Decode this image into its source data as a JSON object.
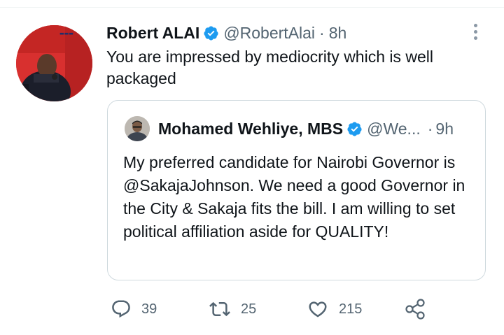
{
  "tweet": {
    "author_name": "Robert ALAI",
    "author_handle": "@RobertAlai",
    "separator": "·",
    "time": "8h",
    "text": "You are impressed by mediocrity which is well packaged"
  },
  "quoted_tweet": {
    "author_name": "Mohamed Wehliye, MBS",
    "author_handle": "@We...",
    "separator": "·",
    "time": "9h",
    "text": "My preferred candidate for Nairobi Governor is @SakajaJohnson. We need a good Governor in the City & Sakaja fits the bill. I am willing to set political affiliation aside for QUALITY!"
  },
  "actions": {
    "reply_count": "39",
    "retweet_count": "25",
    "like_count": "215"
  },
  "icons": {
    "verified": "verified-badge-icon",
    "more": "more-vertical-icon",
    "reply": "reply-bubble-icon",
    "retweet": "retweet-icon",
    "like": "heart-icon",
    "share": "share-icon"
  },
  "colors": {
    "verified_blue": "#1d9bf0",
    "text_primary": "#0f1419",
    "text_secondary": "#536471",
    "border": "#cfd9de"
  }
}
